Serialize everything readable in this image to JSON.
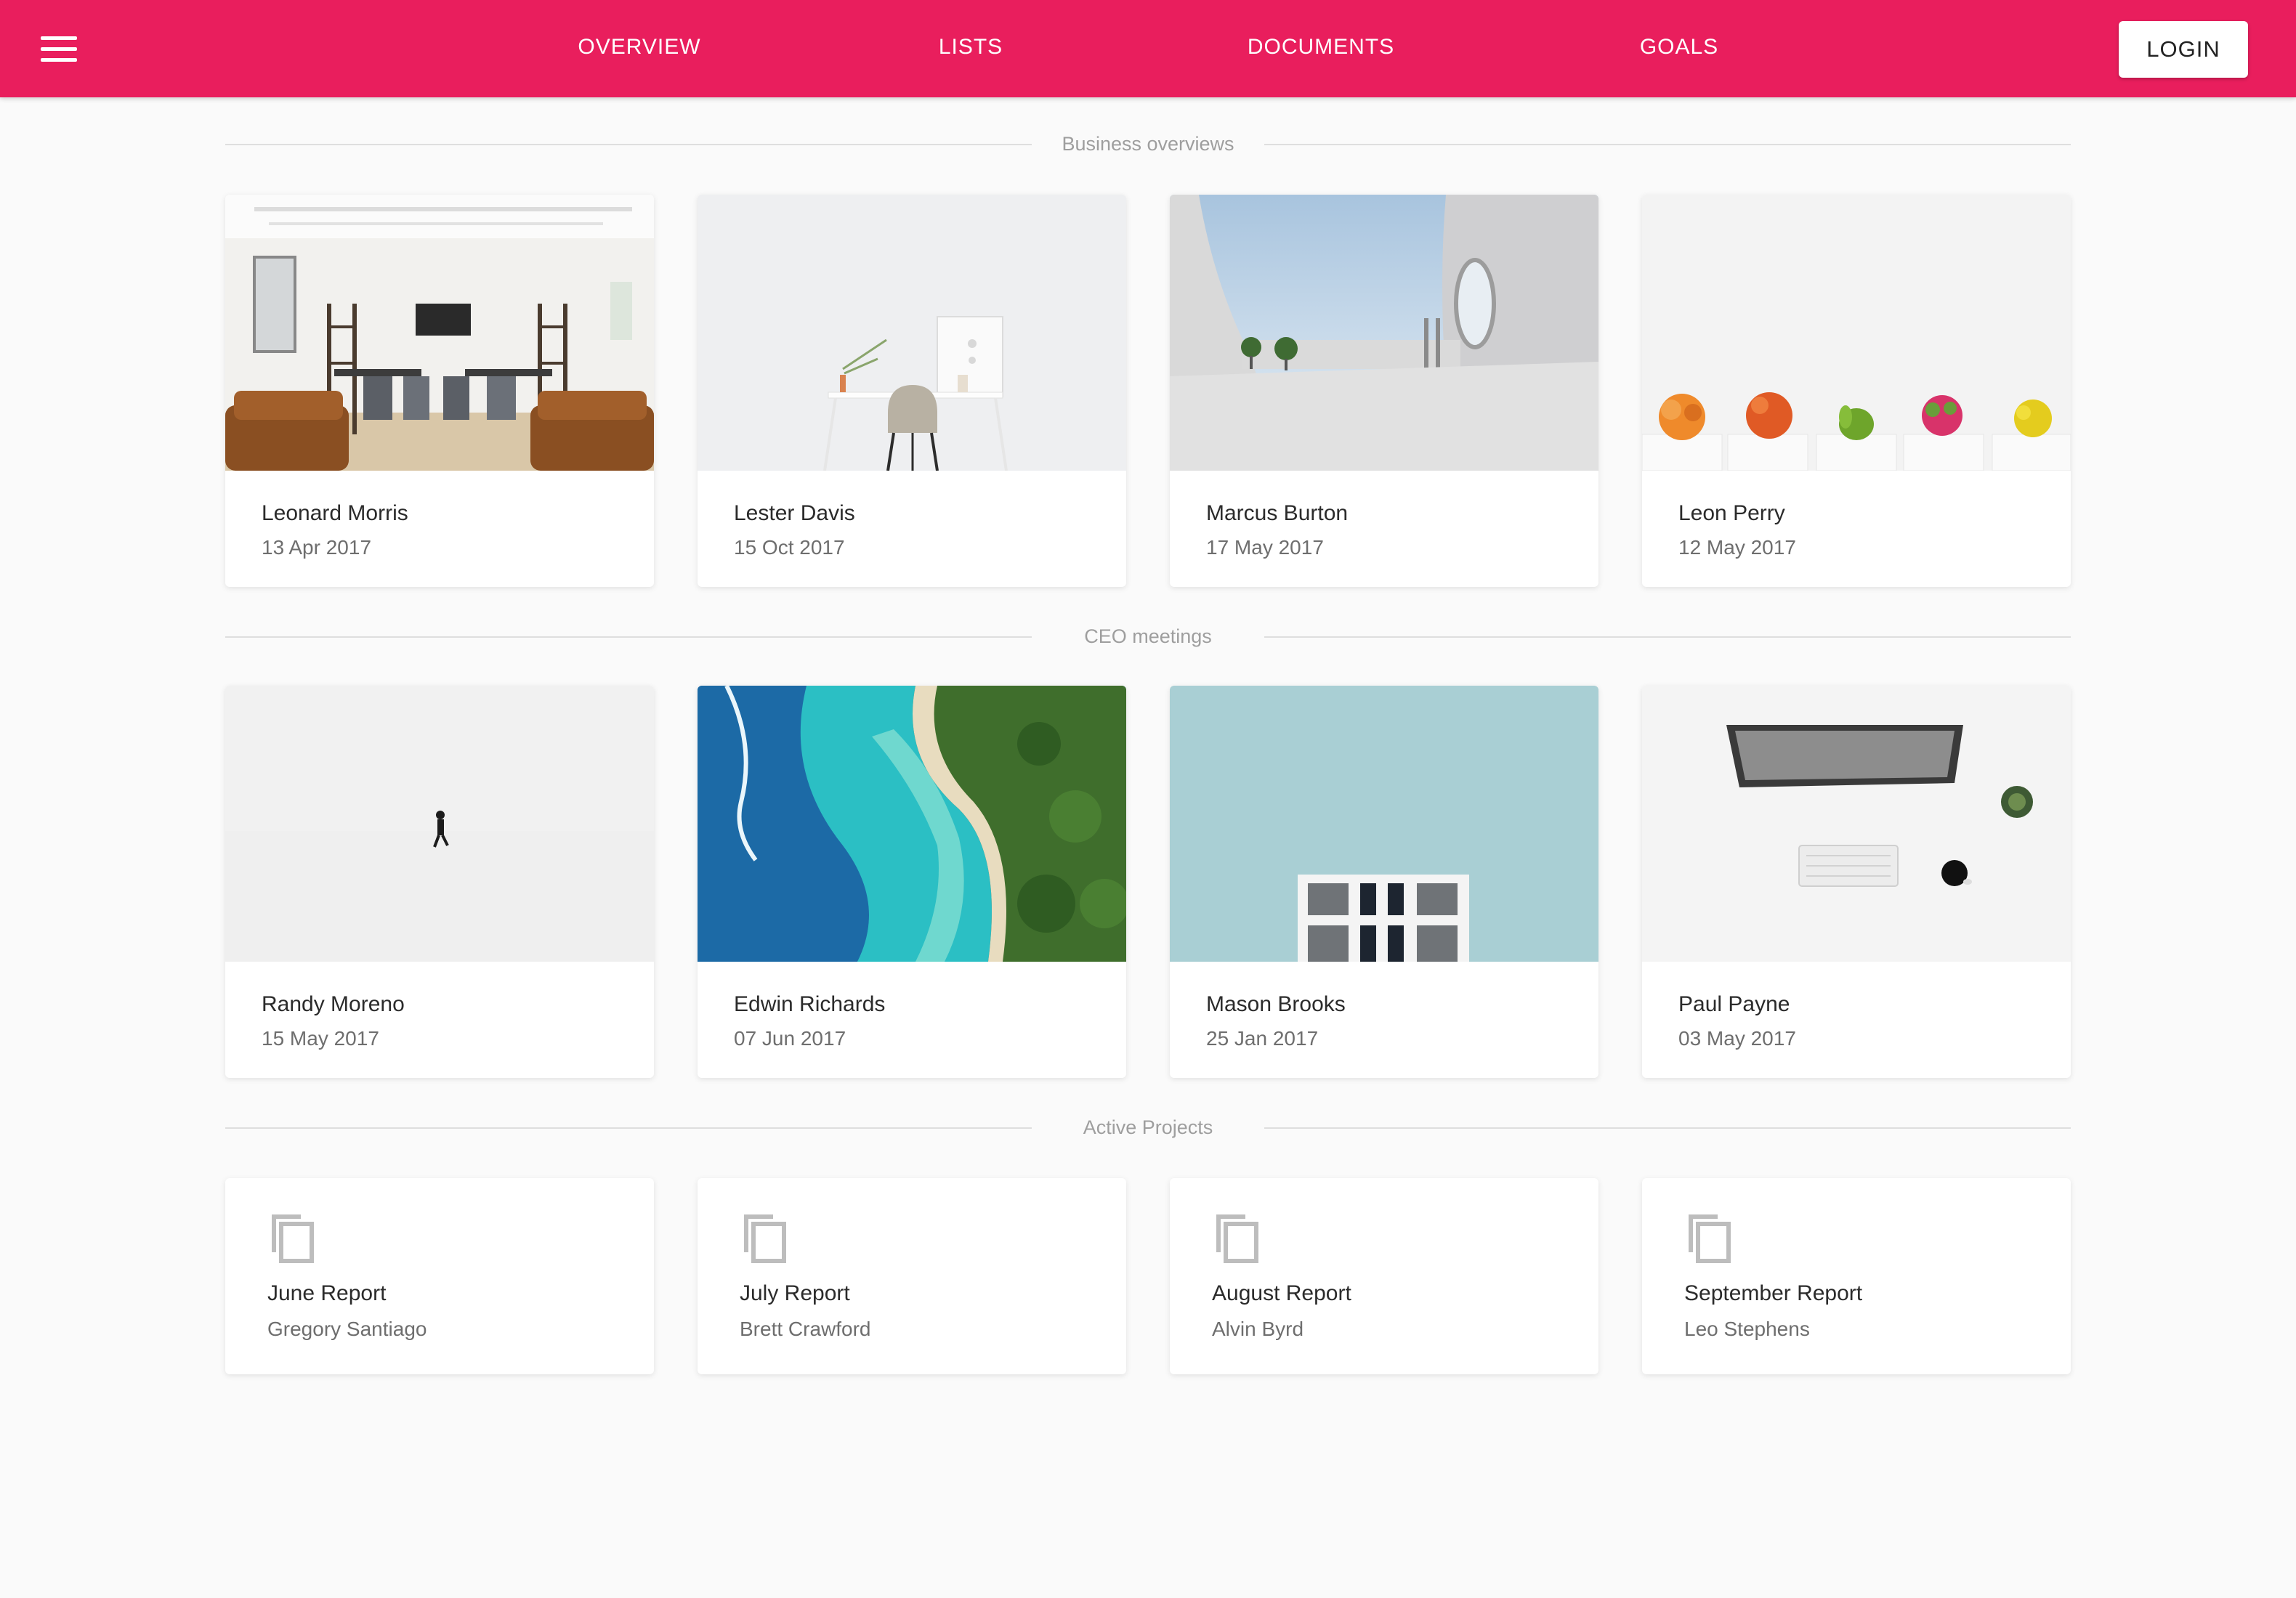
{
  "topbar": {
    "menu_icon": "hamburger-menu-icon",
    "nav": [
      "OVERVIEW",
      "LISTS",
      "DOCUMENTS",
      "GOALS"
    ],
    "login_label": "LOGIN",
    "accent_color": "#e91e5d"
  },
  "sections": {
    "business": {
      "title": "Business overviews",
      "cards": [
        {
          "name": "Leonard Morris",
          "date": "13 Apr 2017"
        },
        {
          "name": "Lester Davis",
          "date": "15 Oct 2017"
        },
        {
          "name": "Marcus Burton",
          "date": "17 May 2017"
        },
        {
          "name": "Leon Perry",
          "date": "12 May 2017"
        }
      ]
    },
    "ceo": {
      "title": "CEO meetings",
      "cards": [
        {
          "name": "Randy Moreno",
          "date": "15 May 2017"
        },
        {
          "name": "Edwin Richards",
          "date": "07 Jun 2017"
        },
        {
          "name": "Mason Brooks",
          "date": "25 Jan 2017"
        },
        {
          "name": "Paul Payne",
          "date": "03 May 2017"
        }
      ]
    },
    "projects": {
      "title": "Active Projects",
      "icon": "document-copy-icon",
      "cards": [
        {
          "name": "June Report",
          "owner": "Gregory Santiago"
        },
        {
          "name": "July Report",
          "owner": "Brett Crawford"
        },
        {
          "name": "August Report",
          "owner": "Alvin Byrd"
        },
        {
          "name": "September Report",
          "owner": "Leo Stephens"
        }
      ]
    }
  }
}
